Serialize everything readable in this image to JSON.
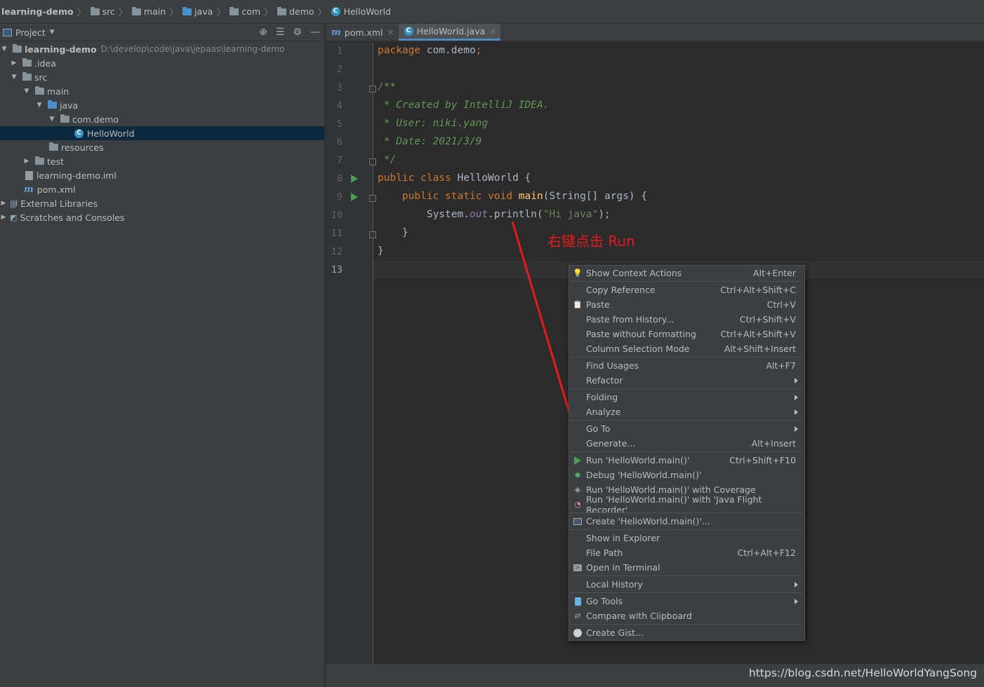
{
  "breadcrumb": [
    "learning-demo",
    "src",
    "main",
    "java",
    "com",
    "demo",
    "HelloWorld"
  ],
  "project_pane": {
    "title": "Project",
    "tree": [
      {
        "label": "learning-demo",
        "path": "D:\\develop\\code\\java\\jepaas\\learning-demo"
      },
      {
        "label": ".idea"
      },
      {
        "label": "src"
      },
      {
        "label": "main"
      },
      {
        "label": "java"
      },
      {
        "label": "com.demo"
      },
      {
        "label": "HelloWorld"
      },
      {
        "label": "resources"
      },
      {
        "label": "test"
      },
      {
        "label": "learning-demo.iml"
      },
      {
        "label": "pom.xml"
      },
      {
        "label": "External Libraries"
      },
      {
        "label": "Scratches and Consoles"
      }
    ]
  },
  "tabs": [
    {
      "label": "pom.xml"
    },
    {
      "label": "HelloWorld.java"
    }
  ],
  "line_numbers": [
    "1",
    "2",
    "3",
    "4",
    "5",
    "6",
    "7",
    "8",
    "9",
    "10",
    "11",
    "12",
    "13"
  ],
  "code": {
    "l1_kw": "package",
    "l1_rest": " com.demo",
    "l1_semi": ";",
    "l3": "/**",
    "l4": " * Created by IntelliJ IDEA.",
    "l5": " * User: niki.yang",
    "l6": " * Date: 2021/3/9",
    "l7": " */",
    "l8_kw": "public class",
    "l8_rest": " HelloWorld {",
    "l9_kw": "    public static void",
    "l9_fn": "main",
    "l9_rest": "(String[] args) {",
    "l10_a": "        System.",
    "l10_out": "out",
    "l10_b": ".println(",
    "l10_str": "\"Hi java\"",
    "l10_c": ");",
    "l11": "    }",
    "l12": "}"
  },
  "annotation": "右键点击 Run",
  "context_menu": [
    {
      "label": "Show Context Actions",
      "shortcut": "Alt+Enter",
      "icon": "bulb-icon"
    },
    {
      "label": "Copy Reference",
      "shortcut": "Ctrl+Alt+Shift+C"
    },
    {
      "label": "Paste",
      "shortcut": "Ctrl+V",
      "icon": "clipboard-icon"
    },
    {
      "label": "Paste from History...",
      "shortcut": "Ctrl+Shift+V"
    },
    {
      "label": "Paste without Formatting",
      "shortcut": "Ctrl+Alt+Shift+V"
    },
    {
      "label": "Column Selection Mode",
      "shortcut": "Alt+Shift+Insert"
    },
    {
      "label": "Find Usages",
      "shortcut": "Alt+F7"
    },
    {
      "label": "Refactor",
      "submenu": true
    },
    {
      "label": "Folding",
      "submenu": true
    },
    {
      "label": "Analyze",
      "submenu": true
    },
    {
      "label": "Go To",
      "submenu": true
    },
    {
      "label": "Generate...",
      "shortcut": "Alt+Insert"
    },
    {
      "label": "Run 'HelloWorld.main()'",
      "shortcut": "Ctrl+Shift+F10",
      "icon": "run-icon"
    },
    {
      "label": "Debug 'HelloWorld.main()'",
      "icon": "debug-icon"
    },
    {
      "label": "Run 'HelloWorld.main()' with Coverage",
      "icon": "coverage-icon"
    },
    {
      "label": "Run 'HelloWorld.main()' with 'Java Flight Recorder'",
      "icon": "flight-recorder-icon"
    },
    {
      "label": "Create 'HelloWorld.main()'...",
      "icon": "create-config-icon"
    },
    {
      "label": "Show in Explorer"
    },
    {
      "label": "File Path",
      "shortcut": "Ctrl+Alt+F12"
    },
    {
      "label": "Open in Terminal",
      "icon": "terminal-icon"
    },
    {
      "label": "Local History",
      "submenu": true
    },
    {
      "label": "Go Tools",
      "submenu": true,
      "icon": "go-tools-icon"
    },
    {
      "label": "Compare with Clipboard",
      "icon": "compare-icon"
    },
    {
      "label": "Create Gist...",
      "icon": "github-icon"
    }
  ],
  "watermark": "https://blog.csdn.net/HelloWorldYangSong",
  "colors": {
    "run_green": "#499c54",
    "annotation_red": "#e8191a",
    "selection": "#0d293e"
  }
}
